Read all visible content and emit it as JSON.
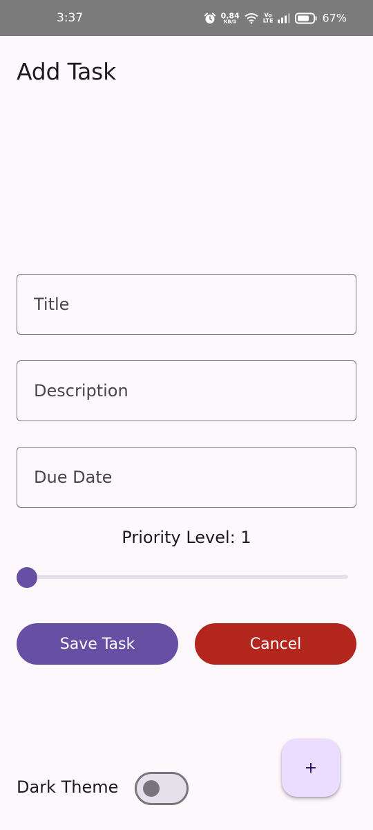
{
  "status_bar": {
    "time": "3:37",
    "net_speed_value": "0.84",
    "net_speed_unit": "KB/S",
    "volte_top": "Vo",
    "volte_bottom": "LTE",
    "battery_percent": "67%",
    "icons": [
      "alarm-icon",
      "wifi-icon",
      "signal-icon",
      "battery-icon"
    ]
  },
  "header": {
    "title": "Add Task"
  },
  "form": {
    "title_placeholder": "Title",
    "description_placeholder": "Description",
    "due_date_placeholder": "Due Date",
    "priority_label": "Priority Level: 1",
    "priority_value": 1
  },
  "actions": {
    "save_label": "Save Task",
    "cancel_label": "Cancel"
  },
  "fab": {
    "label": "+",
    "icon": "add-icon"
  },
  "footer": {
    "dark_theme_label": "Dark Theme",
    "dark_theme_on": false
  },
  "colors": {
    "primary": "#6750a4",
    "error": "#b3261e",
    "fab_container": "#eaddff",
    "background": "#fdf8fc",
    "status_bar": "#7b7b7b"
  }
}
